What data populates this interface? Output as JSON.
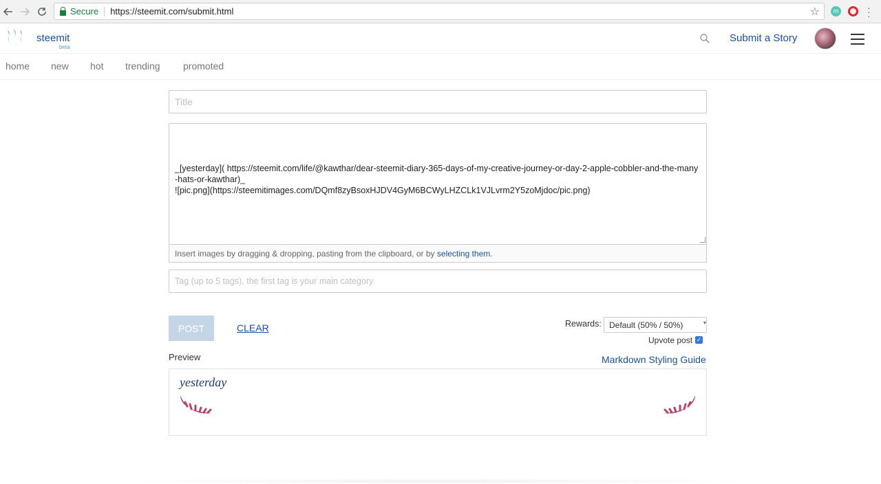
{
  "browser": {
    "secure_label": "Secure",
    "url": "https://steemit.com/submit.html",
    "extension_initial": "m"
  },
  "header": {
    "brand": "steemit",
    "beta": "beta",
    "submit_story": "Submit a Story"
  },
  "subnav": {
    "items": [
      "home",
      "new",
      "hot",
      "trending",
      "promoted"
    ]
  },
  "form": {
    "title_placeholder": "Title",
    "body_text": "_[yesterday]( https://steemit.com/life/@kawthar/dear-steemit-diary-365-days-of-my-creative-journey-or-day-2-apple-cobbler-and-the-many-hats-or-kawthar)_\n![pic.png](https://steemitimages.com/DQmf8zyBsoxHJDV4GyM6BCWyLHZCLk1VJLvrm2Y5zoMjdoc/pic.png)",
    "drop_hint_prefix": "Insert images by dragging & dropping, pasting from the clipboard, or by ",
    "drop_hint_link": "selecting them",
    "drop_hint_suffix": ".",
    "tag_placeholder": "Tag (up to 5 tags), the first tag is your main category."
  },
  "actions": {
    "post": "POST",
    "clear": "CLEAR",
    "rewards_label": "Rewards:",
    "rewards_value": "Default (50% / 50%)",
    "upvote_label": "Upvote post",
    "upvote_checked": true
  },
  "preview": {
    "label": "Preview",
    "guide_link": "Markdown Styling Guide",
    "title": "yesterday"
  },
  "colors": {
    "link_blue": "#1a5099",
    "flourish_pink": "#b5436e",
    "post_disabled": "#c4d5e8"
  }
}
